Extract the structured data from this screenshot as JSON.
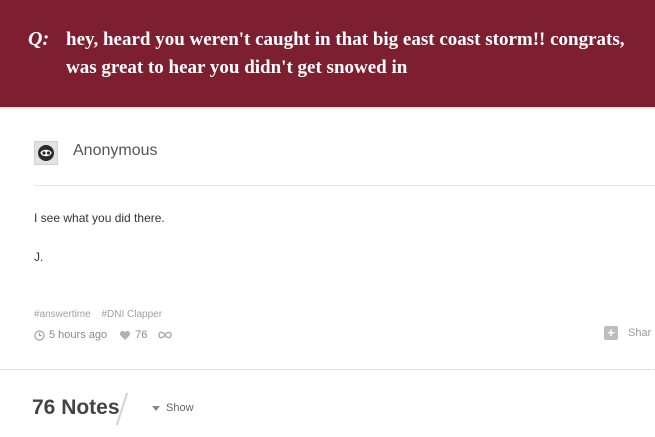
{
  "question": {
    "label": "Q:",
    "text": "hey, heard you weren't caught in that big east coast storm!! congrats, was great to hear you didn't get snowed in"
  },
  "answer": {
    "asker": "Anonymous",
    "paragraphs": [
      "I see what you did there.",
      "J."
    ]
  },
  "tags": [
    "#answertime",
    "#DNI Clapper"
  ],
  "meta": {
    "time": "5 hours ago",
    "likes": "76"
  },
  "share_label": "Shar",
  "notes": {
    "count_label": "76 Notes",
    "show_label": "Show"
  },
  "colors": {
    "question_bg": "#7e1f31"
  }
}
